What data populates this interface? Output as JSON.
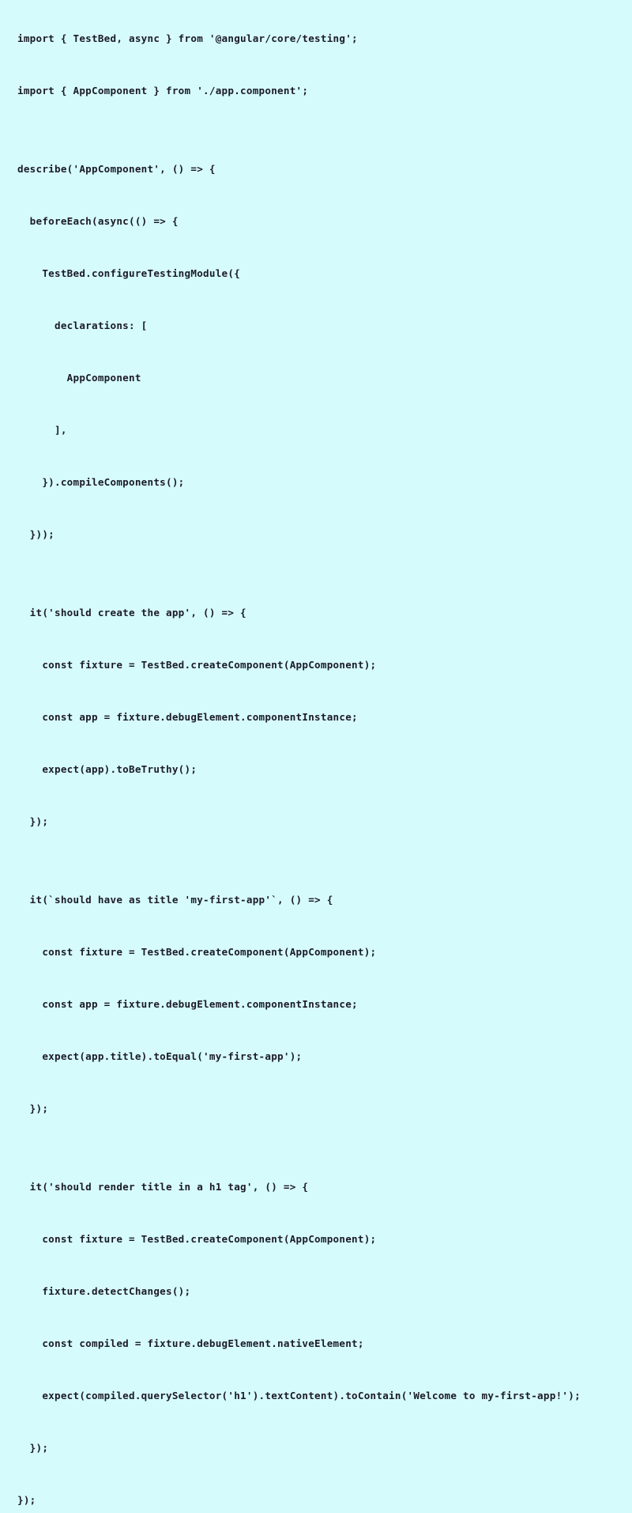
{
  "editor": {
    "language": "typescript",
    "background_color": "#d6fbfd",
    "text_color": "#1b1b26",
    "font_weight": "bold",
    "line_height_px": 33
  },
  "code": {
    "lines": [
      "import { TestBed, async } from '@angular/core/testing';",
      "",
      "import { AppComponent } from './app.component';",
      "",
      "",
      "describe('AppComponent', () => {",
      "",
      "  beforeEach(async(() => {",
      "",
      "    TestBed.configureTestingModule({",
      "",
      "      declarations: [",
      "",
      "        AppComponent",
      "",
      "      ],",
      "",
      "    }).compileComponents();",
      "",
      "  }));",
      "",
      "",
      "  it('should create the app', () => {",
      "",
      "    const fixture = TestBed.createComponent(AppComponent);",
      "",
      "    const app = fixture.debugElement.componentInstance;",
      "",
      "    expect(app).toBeTruthy();",
      "",
      "  });",
      "",
      "",
      "  it(`should have as title 'my-first-app'`, () => {",
      "",
      "    const fixture = TestBed.createComponent(AppComponent);",
      "",
      "    const app = fixture.debugElement.componentInstance;",
      "",
      "    expect(app.title).toEqual('my-first-app');",
      "",
      "  });",
      "",
      "",
      "  it('should render title in a h1 tag', () => {",
      "",
      "    const fixture = TestBed.createComponent(AppComponent);",
      "",
      "    fixture.detectChanges();",
      "",
      "    const compiled = fixture.debugElement.nativeElement;",
      "",
      "    expect(compiled.querySelector('h1').textContent).toContain('Welcome to my-first-app!');",
      "",
      "  });",
      "",
      "});"
    ]
  }
}
